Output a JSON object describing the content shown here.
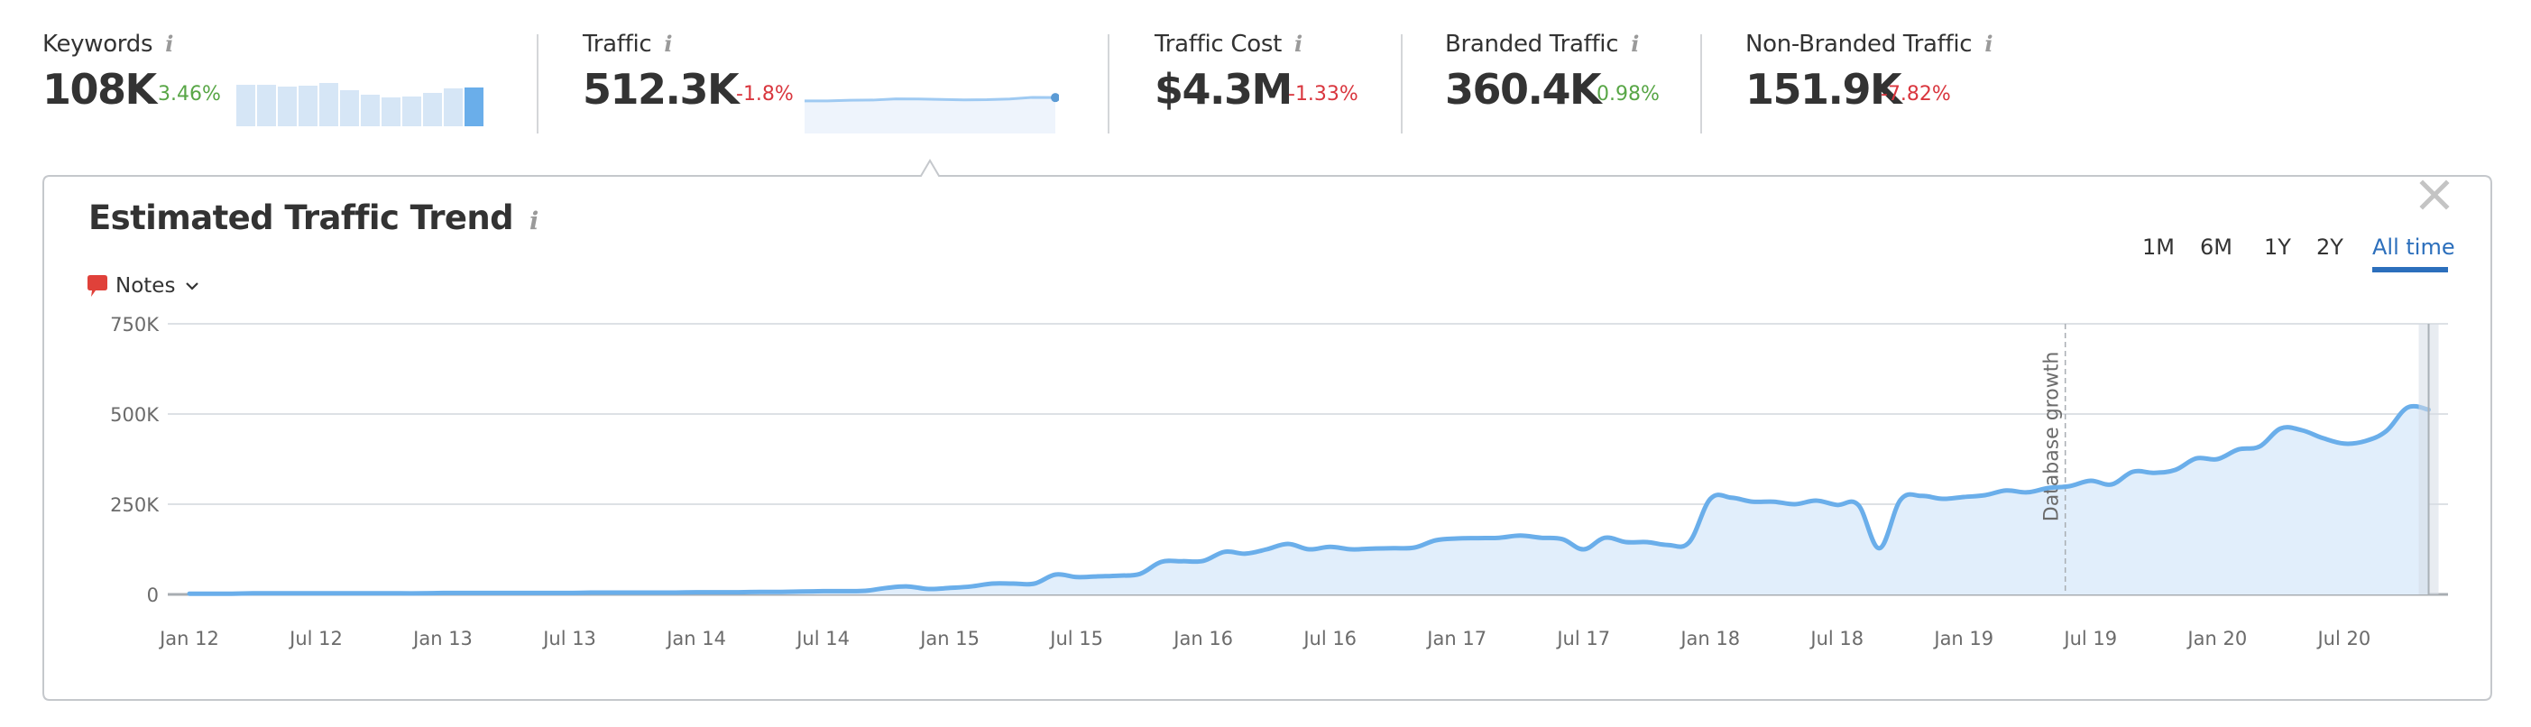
{
  "metrics": [
    {
      "label": "Keywords",
      "value": "108K",
      "delta": "3.46%",
      "delta_direction": "positive",
      "info_icon": "info-icon",
      "sparkline": {
        "type": "bar",
        "relative_values": [
          115,
          115,
          112,
          114,
          121,
          100,
          88,
          80,
          82,
          94,
          105,
          109
        ],
        "highlight_last": true
      }
    },
    {
      "label": "Traffic",
      "value": "512.3K",
      "delta": "-1.8%",
      "delta_direction": "negative",
      "info_icon": "info-icon",
      "selected": true,
      "sparkline": {
        "type": "area",
        "values": [
          377,
          375,
          402,
          410,
          460,
          455,
          433,
          418,
          425,
          453,
          518,
          512
        ]
      }
    },
    {
      "label": "Traffic Cost",
      "value": "$4.3M",
      "delta": "-1.33%",
      "delta_direction": "negative",
      "info_icon": "info-icon"
    },
    {
      "label": "Branded Traffic",
      "value": "360.4K",
      "delta": "0.98%",
      "delta_direction": "positive",
      "info_icon": "info-icon"
    },
    {
      "label": "Non-Branded Traffic",
      "value": "151.9K",
      "delta": "-7.82%",
      "delta_direction": "negative",
      "info_icon": "info-icon"
    }
  ],
  "panel": {
    "title": "Estimated Traffic Trend",
    "notes_label": "Notes",
    "close_icon": "close-icon",
    "time_ranges": [
      {
        "label": "1M",
        "active": false
      },
      {
        "label": "6M",
        "active": false
      },
      {
        "label": "1Y",
        "active": false
      },
      {
        "label": "2Y",
        "active": false
      },
      {
        "label": "All time",
        "active": true
      }
    ]
  },
  "colors": {
    "line": "#6aaeea",
    "area": "#e1eefb",
    "positive": "#58a646",
    "negative": "#d9363e",
    "active_tab": "#2c6fbc",
    "notes_icon": "#e0413a"
  },
  "chart_data": {
    "type": "area",
    "title": "Estimated Traffic Trend",
    "xlabel": "",
    "ylabel": "",
    "x_start": "Jan 2012",
    "x_end": "Nov 2020",
    "x_interval": "monthly",
    "x_ticks": [
      "Jan 12",
      "Jul 12",
      "Jan 13",
      "Jul 13",
      "Jan 14",
      "Jul 14",
      "Jan 15",
      "Jul 15",
      "Jan 16",
      "Jul 16",
      "Jan 17",
      "Jul 17",
      "Jan 18",
      "Jul 18",
      "Jan 19",
      "Jul 19",
      "Jan 20",
      "Jul 20"
    ],
    "y_ticks": [
      "0",
      "250K",
      "500K",
      "750K"
    ],
    "y_tick_values": [
      0,
      250000,
      500000,
      750000
    ],
    "ylim": [
      0,
      750000
    ],
    "grid": true,
    "legend": "none",
    "series": [
      {
        "name": "Traffic",
        "unit": "K",
        "values": [
          2,
          2,
          2,
          3,
          3,
          3,
          3,
          3,
          3,
          3,
          3,
          3,
          4,
          4,
          4,
          4,
          4,
          4,
          4,
          5,
          5,
          5,
          5,
          5,
          6,
          6,
          6,
          7,
          7,
          8,
          9,
          9,
          10,
          18,
          22,
          15,
          18,
          22,
          30,
          30,
          30,
          55,
          48,
          50,
          52,
          57,
          90,
          92,
          93,
          118,
          113,
          125,
          140,
          125,
          132,
          125,
          127,
          128,
          130,
          150,
          155,
          156,
          157,
          163,
          157,
          153,
          125,
          157,
          145,
          145,
          137,
          145,
          265,
          268,
          257,
          257,
          250,
          260,
          248,
          248,
          128,
          262,
          273,
          265,
          270,
          275,
          288,
          283,
          295,
          300,
          315,
          305,
          340,
          337,
          345,
          377,
          375,
          402,
          410,
          460,
          455,
          433,
          418,
          425,
          453,
          518,
          512
        ]
      }
    ],
    "annotations": [
      {
        "label": "Database growth",
        "at_month_index": 88.8,
        "approx_date": "May 2019",
        "style": "dashed-vertical"
      }
    ],
    "hover_marker": {
      "month_index": 106,
      "value": 512
    }
  }
}
